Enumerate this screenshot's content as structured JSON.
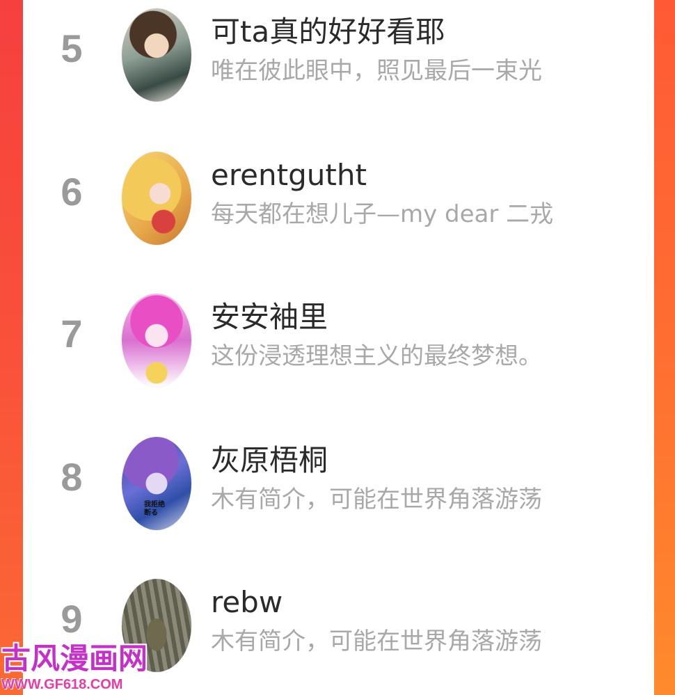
{
  "ranking": [
    {
      "rank": "5",
      "name": "可ta真的好好看耶",
      "bio": "唯在彼此眼中，照见最后一束光"
    },
    {
      "rank": "6",
      "name": "erentgutht",
      "bio": "每天都在想儿子—my dear 二戎"
    },
    {
      "rank": "7",
      "name": "安安袖里",
      "bio": "这份浸透理想主义的最终梦想。"
    },
    {
      "rank": "8",
      "name": "灰原梧桐",
      "bio": "木有简介，可能在世界角落游荡",
      "avatar_caption": "我拒绝\n断る"
    },
    {
      "rank": "9",
      "name": "rebw",
      "bio": "木有简介，可能在世界角落游荡"
    }
  ],
  "watermark": {
    "title": "古风漫画网",
    "url": "WWW.GF618.COM"
  },
  "colors": {
    "frame_orange": "#fc5a36",
    "rank_gray": "#9a9a9a",
    "name_dark": "#2a2a2a",
    "bio_gray": "#a8a8a8",
    "watermark_magenta": "#c430c8"
  }
}
